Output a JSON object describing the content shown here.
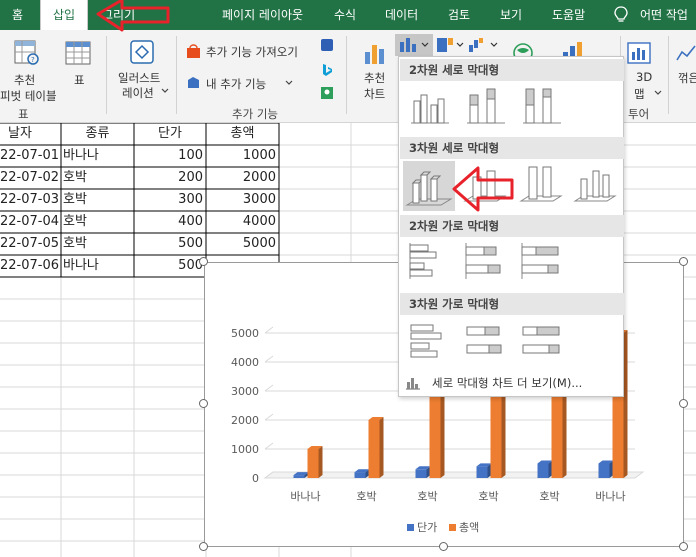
{
  "tabs": [
    "홈",
    "삽입",
    "그리기",
    "페이지 레이아웃",
    "수식",
    "데이터",
    "검토",
    "보기",
    "도움말"
  ],
  "tell_me": "어떤 작업",
  "ribbon": {
    "pivot_label_1": "추천",
    "pivot_label_2": "피벗 테이블",
    "table_label": "표",
    "illustrations_label_1": "일러스트",
    "illustrations_label_2": "레이션",
    "get_addins": "추가 기능 가져오기",
    "my_addins": "내 추가 기능",
    "recommended_chart_1": "추천",
    "recommended_chart_2": "차트",
    "map3d_1": "3D",
    "map3d_2": "맵",
    "sparkline": "꺾은",
    "group_tables": "표",
    "group_addins": "추가 기능",
    "group_tours": "투어"
  },
  "table": {
    "headers": [
      "날자",
      "종류",
      "단가",
      "총액"
    ],
    "rows": [
      [
        "22-07-01",
        "바나나",
        "100",
        "1000"
      ],
      [
        "22-07-02",
        "호박",
        "200",
        "2000"
      ],
      [
        "22-07-03",
        "호박",
        "300",
        "3000"
      ],
      [
        "22-07-04",
        "호박",
        "400",
        "4000"
      ],
      [
        "22-07-05",
        "호박",
        "500",
        "5000"
      ],
      [
        "22-07-06",
        "바나나",
        "500",
        ""
      ]
    ]
  },
  "chart_dropdown": {
    "sections": [
      "2차원 세로 막대형",
      "3차원 세로 막대형",
      "2차원 가로 막대형",
      "3차원 가로 막대형"
    ],
    "more": "세로 막대형 차트 더 보기(M)..."
  },
  "chart_data": {
    "type": "bar",
    "categories": [
      "바나나",
      "호박",
      "호박",
      "호박",
      "호박",
      "바나나"
    ],
    "series": [
      {
        "name": "단가",
        "values": [
          100,
          200,
          300,
          400,
          500,
          500
        ],
        "color": "#4472c4"
      },
      {
        "name": "총액",
        "values": [
          1000,
          2000,
          3000,
          4000,
          5000,
          5000
        ],
        "color": "#ed7d31"
      }
    ],
    "yticks": [
      "0",
      "1000",
      "2000",
      "3000",
      "4000",
      "5000"
    ],
    "ylim": [
      0,
      5000
    ],
    "legend": "bottom",
    "grid": true
  },
  "colors": {
    "excel_green": "#217346",
    "annotation_red": "#e8222a"
  }
}
